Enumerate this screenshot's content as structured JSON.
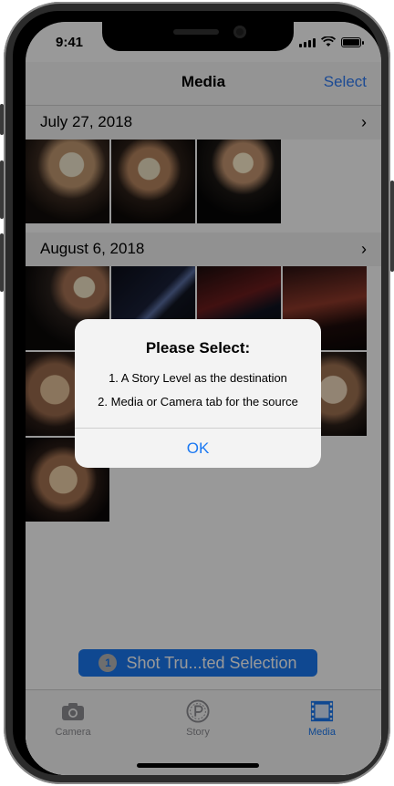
{
  "status_bar": {
    "time": "9:41"
  },
  "nav": {
    "title": "Media",
    "select_label": "Select"
  },
  "sections": [
    {
      "date": "July 27, 2018",
      "count": 3
    },
    {
      "date": "August 6, 2018",
      "count": 10
    }
  ],
  "floating_button": {
    "count": "1",
    "label": "Shot Tru...ted Selection"
  },
  "alert": {
    "title": "Please Select:",
    "line1": "1. A Story Level as the destination",
    "line2": "2. Media or Camera tab for the source",
    "ok_label": "OK"
  },
  "tabs": [
    {
      "label": "Camera",
      "icon": "camera-icon",
      "active": false
    },
    {
      "label": "Story",
      "icon": "story-icon",
      "active": false
    },
    {
      "label": "Media",
      "icon": "media-icon",
      "active": true
    }
  ],
  "colors": {
    "accent": "#1a78f2",
    "select_link": "#2f7cf6",
    "dim_overlay": "rgba(0,0,0,0.40)"
  }
}
